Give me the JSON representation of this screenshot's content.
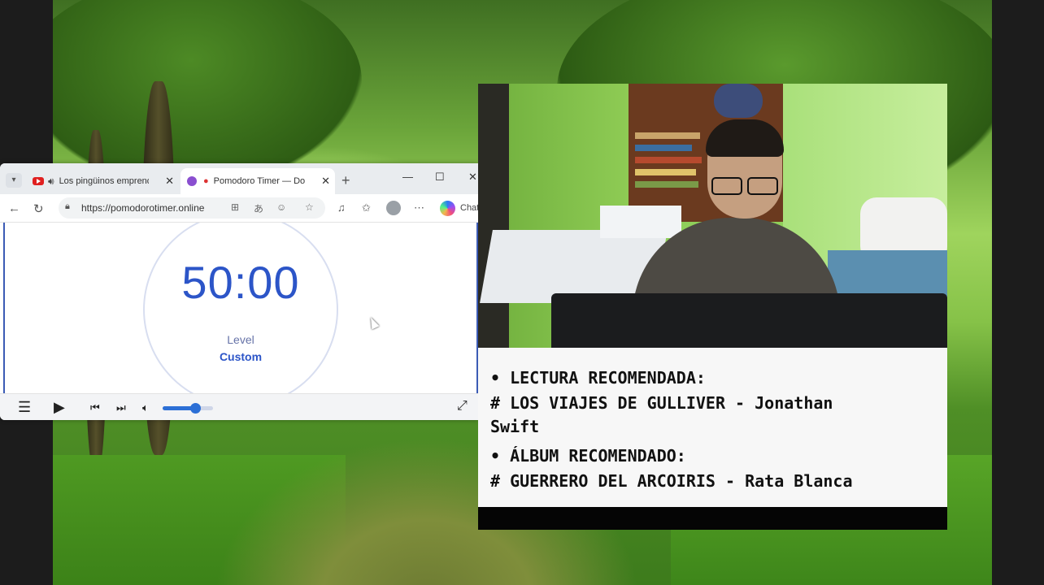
{
  "browser": {
    "tabs": [
      {
        "label": "Los pingüinos emprend",
        "favicon": "youtube-icon",
        "muted_icon": "speaker-icon",
        "active": false
      },
      {
        "label": "Pomodoro Timer — Do n",
        "favicon": "tomato-icon",
        "active": true
      }
    ],
    "url": "https://pomodorotimer.online",
    "chat_label": "Chat"
  },
  "timer": {
    "value": "50:00",
    "level_label": "Level",
    "level_value": "Custom"
  },
  "player": {
    "volume_level": 0.65
  },
  "recommendations": {
    "reading_heading": "• LECTURA RECOMENDADA:",
    "reading_item_line1": "# LOS VIAJES DE GULLIVER - Jonathan",
    "reading_item_line2": "Swift",
    "album_heading": "• ÁLBUM RECOMENDADO:",
    "album_item": "# GUERRERO DEL ARCOIRIS - Rata Blanca"
  },
  "colors": {
    "accent": "#2c55c8",
    "volume": "#2c6fd6"
  }
}
